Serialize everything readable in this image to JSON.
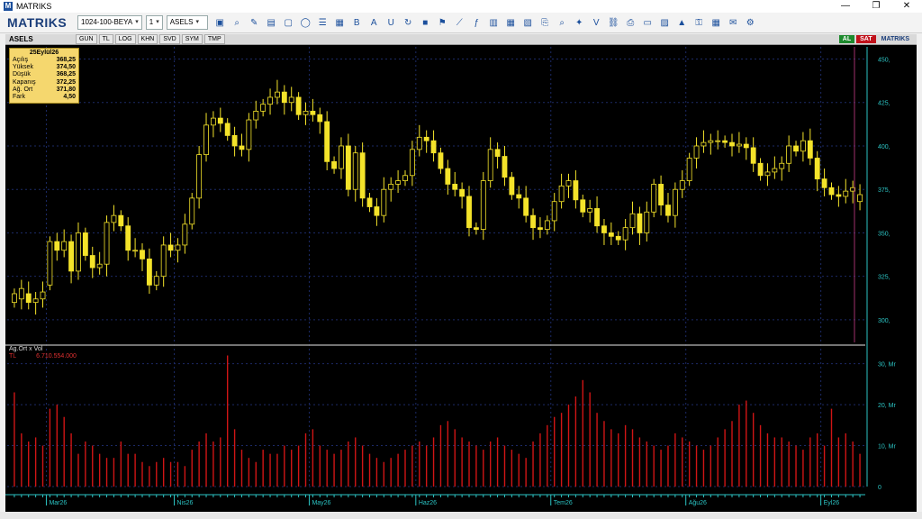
{
  "window": {
    "title": "MATRIKS",
    "controls": [
      "—",
      "❐",
      "✕"
    ]
  },
  "toolbar": {
    "brand": "MATRIKS",
    "layout_select": "1024-100-BEYA",
    "page_number": "1",
    "symbol_select": "ASELS",
    "icons": [
      "save-icon",
      "zoom-icon",
      "draw-icon",
      "bar-chart-icon",
      "window-icon",
      "circle-icon",
      "list-icon",
      "table-icon",
      "bold-icon",
      "font-color-icon",
      "underline-icon",
      "refresh-icon",
      "stop-icon",
      "flag-icon",
      "line-chart-icon",
      "formula-icon",
      "report-icon",
      "grid-icon",
      "layout-icon",
      "copy-icon",
      "search-icon",
      "twitter-icon",
      "v-icon",
      "link-icon",
      "print-icon",
      "monitor-icon",
      "tile-icon",
      "alert-icon",
      "key-icon",
      "calc-icon",
      "chat-icon",
      "settings-icon"
    ]
  },
  "subbar": {
    "symbol": "ASELS",
    "tabs": [
      "GUN",
      "TL",
      "LOG",
      "KHN",
      "SVD",
      "SYM",
      "TMP"
    ],
    "al": "AL",
    "sat": "SAT",
    "brand": "MATRIKS"
  },
  "infobox": {
    "date": "25Eylül26",
    "rows": [
      {
        "label": "Açılış",
        "value": "368,25"
      },
      {
        "label": "Yüksek",
        "value": "374,50"
      },
      {
        "label": "Düşük",
        "value": "368,25"
      },
      {
        "label": "Kapanış",
        "value": "372,25"
      },
      {
        "label": "Ağ. Ort",
        "value": "371,80"
      },
      {
        "label": "Fark",
        "value": "4,50"
      }
    ]
  },
  "volume_panel": {
    "title": "Ag.Ort x Vol",
    "unit": "TL",
    "value": "6.710.554.000"
  },
  "chart_data": [
    {
      "type": "candlestick",
      "ylim": [
        287,
        457
      ],
      "y_ticks": [
        "450,",
        "425,",
        "400,",
        "375,",
        "350,",
        "325,",
        "300,"
      ],
      "y_tick_values": [
        450,
        425,
        400,
        375,
        350,
        325,
        300
      ],
      "x_labels": [
        "Mar26",
        "Nis26",
        "May26",
        "Haz26",
        "Tem26",
        "Ağu26",
        "Eyl26"
      ],
      "x_label_index": [
        6,
        24,
        43,
        58,
        77,
        96,
        115
      ],
      "closes": [
        315,
        318,
        310,
        312,
        316,
        345,
        340,
        345,
        328,
        350,
        337,
        330,
        332,
        356,
        360,
        354,
        340,
        340,
        335,
        320,
        325,
        343,
        340,
        343,
        355,
        370,
        395,
        412,
        416,
        413,
        406,
        400,
        398,
        415,
        420,
        424,
        428,
        431,
        425,
        428,
        418,
        420,
        418,
        414,
        391,
        387,
        400,
        375,
        396,
        370,
        365,
        360,
        375,
        378,
        380,
        383,
        398,
        405,
        403,
        396,
        387,
        378,
        375,
        371,
        353,
        352,
        380,
        398,
        394,
        382,
        372,
        370,
        360,
        353,
        352,
        357,
        368,
        377,
        380,
        369,
        362,
        364,
        354,
        350,
        348,
        346,
        353,
        361,
        350,
        362,
        378,
        366,
        360,
        375,
        380,
        393,
        400,
        402,
        403,
        403,
        402,
        400,
        401,
        399,
        390,
        383,
        385,
        387,
        390,
        400,
        397,
        403,
        393,
        381,
        376,
        372,
        371,
        374,
        376,
        372
      ],
      "opens": [
        310,
        312,
        315,
        310,
        312,
        320,
        345,
        340,
        345,
        328,
        350,
        337,
        330,
        332,
        356,
        360,
        354,
        340,
        340,
        335,
        320,
        325,
        343,
        340,
        343,
        355,
        370,
        395,
        412,
        416,
        413,
        406,
        400,
        398,
        415,
        420,
        424,
        428,
        431,
        425,
        428,
        418,
        420,
        418,
        414,
        391,
        387,
        400,
        375,
        396,
        370,
        365,
        360,
        375,
        378,
        380,
        383,
        398,
        405,
        403,
        396,
        387,
        378,
        375,
        371,
        353,
        352,
        380,
        398,
        394,
        382,
        372,
        370,
        360,
        353,
        352,
        357,
        368,
        377,
        380,
        369,
        362,
        364,
        354,
        350,
        348,
        346,
        353,
        361,
        350,
        362,
        378,
        366,
        360,
        375,
        380,
        393,
        400,
        402,
        403,
        403,
        402,
        400,
        401,
        399,
        390,
        383,
        385,
        387,
        390,
        400,
        397,
        403,
        393,
        381,
        376,
        372,
        371,
        374,
        368
      ],
      "volume_ylim": [
        0,
        33
      ],
      "volume_ticks": [
        "30, Mr",
        "20, Mr",
        "10, Mr",
        "0"
      ],
      "volume_tick_values": [
        30,
        20,
        10,
        0
      ],
      "volume": [
        23,
        13,
        11,
        12,
        10,
        19,
        20,
        17,
        13,
        8,
        11,
        10,
        8,
        7,
        7,
        11,
        8,
        8,
        6,
        5,
        6,
        7,
        6,
        6,
        5,
        9,
        11,
        13,
        11,
        12,
        32,
        14,
        9,
        7,
        6,
        9,
        8,
        8,
        10,
        9,
        10,
        13,
        14,
        10,
        9,
        8,
        9,
        11,
        12,
        10,
        8,
        7,
        6,
        7,
        8,
        9,
        10,
        11,
        10,
        12,
        15,
        16,
        14,
        12,
        11,
        10,
        9,
        11,
        12,
        10,
        9,
        8,
        7,
        11,
        13,
        15,
        17,
        18,
        20,
        22,
        26,
        23,
        18,
        16,
        14,
        13,
        15,
        14,
        12,
        11,
        10,
        9,
        10,
        13,
        12,
        11,
        10,
        9,
        10,
        12,
        14,
        16,
        20,
        21,
        18,
        15,
        13,
        12,
        12,
        11,
        10,
        9,
        12,
        13,
        10,
        19,
        12,
        13,
        11,
        8
      ]
    }
  ],
  "colors": {
    "background": "#000000",
    "candle": "#f4e32a",
    "wick": "#f4e32a",
    "volume": "#d01515",
    "grid": "#1c2a66",
    "axis": "#2bc3c3",
    "divider": "#9a9a9a"
  }
}
